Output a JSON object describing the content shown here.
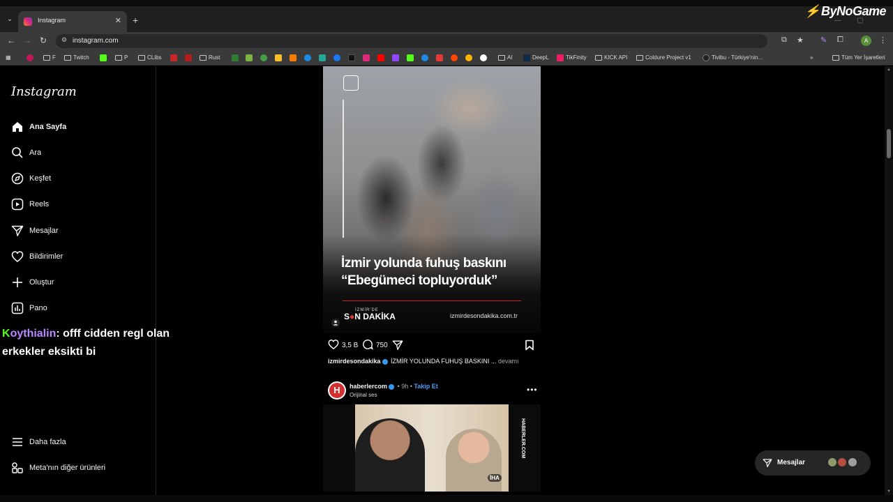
{
  "browser": {
    "tab_title": "Instagram",
    "url": "instagram.com",
    "brand": "ByNoGame",
    "bookmarks": [
      "F",
      "Twitch",
      "P",
      "CLibs",
      "Rust",
      "AI",
      "DeepL",
      "TikFinity",
      "KICK API",
      "Coldure Project v1",
      "Tivibu - Türkiye'nin...",
      "Tüm Yer İşaretleri"
    ]
  },
  "sidebar": {
    "logo": "Instagram",
    "items": [
      {
        "label": "Ana Sayfa",
        "icon": "home-icon"
      },
      {
        "label": "Ara",
        "icon": "search-icon"
      },
      {
        "label": "Keşfet",
        "icon": "compass-icon"
      },
      {
        "label": "Reels",
        "icon": "reels-icon"
      },
      {
        "label": "Mesajlar",
        "icon": "send-icon"
      },
      {
        "label": "Bildirimler",
        "icon": "heart-icon"
      },
      {
        "label": "Oluştur",
        "icon": "plus-icon"
      },
      {
        "label": "Pano",
        "icon": "chart-icon"
      }
    ],
    "more": "Daha fazla",
    "meta": "Meta'nın diğer ürünleri"
  },
  "post1": {
    "headline_line1": "İzmir yolunda fuhuş baskını",
    "headline_line2": "“Ebegümeci topluyorduk”",
    "brand_small": "İZMİR'DE",
    "brand_big_pre": "S",
    "brand_big_post": "N DAKİKA",
    "site": "izmirdesondakika.com.tr",
    "likes": "3,5 B",
    "comments": "750",
    "caption_user": "izmirdesondakika",
    "caption_text": "İZMİR YOLUNDA FUHUŞ BASKINI ...",
    "caption_more": "devamı"
  },
  "post2": {
    "avatar_letter": "H",
    "user": "haberlercom",
    "time": "9h",
    "follow": "Takip Et",
    "audio": "Orijinal ses",
    "watermark": "HABERLER.COM",
    "iha": "İHA"
  },
  "chat": {
    "kick": "K",
    "user": "oythialin",
    "text": ": offf cidden regl olan erkekler eksikti bi"
  },
  "messages": {
    "label": "Mesajlar"
  },
  "colors": {
    "background": "#000000",
    "accent": "#4a9ff5",
    "chat_user": "#b987ff",
    "kick_green": "#53fc18"
  }
}
